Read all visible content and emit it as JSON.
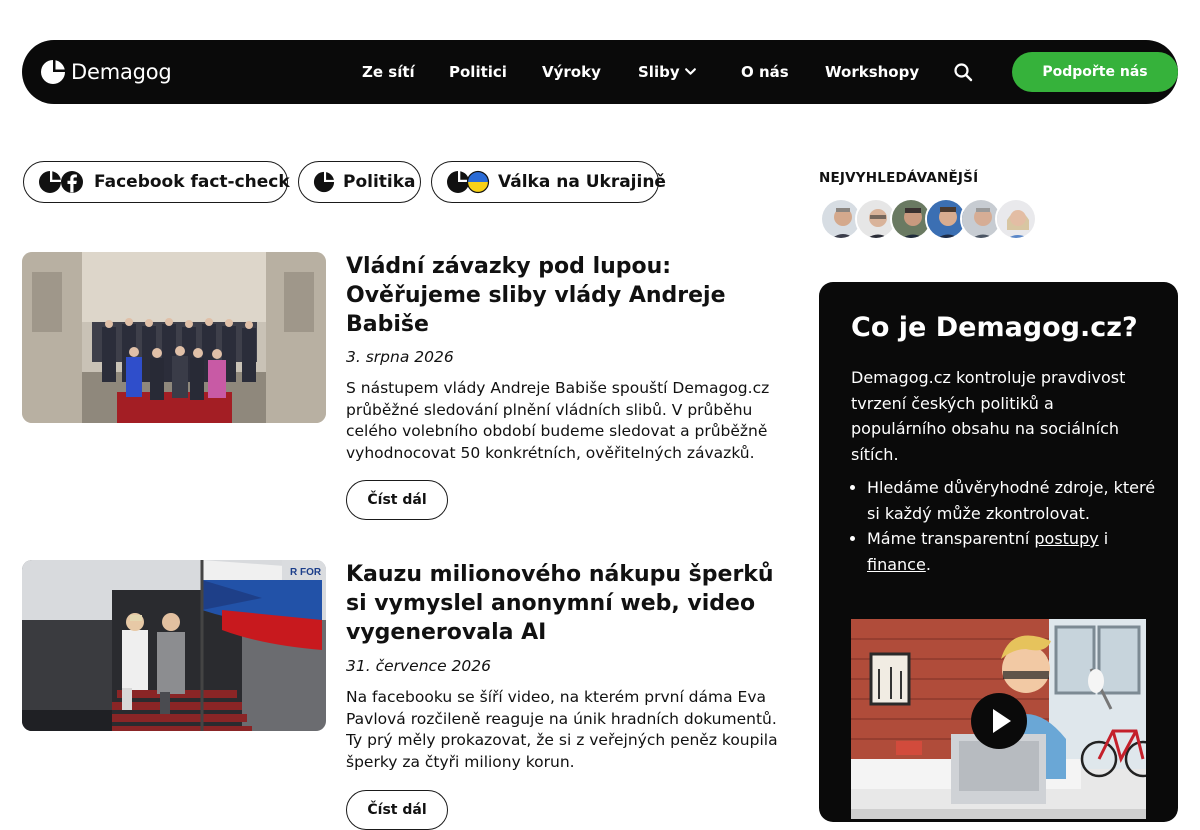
{
  "brand": {
    "name": "Demagog"
  },
  "nav": {
    "items": [
      {
        "label": "Ze sítí"
      },
      {
        "label": "Politici"
      },
      {
        "label": "Výroky"
      },
      {
        "label": "Sliby"
      },
      {
        "label": "O nás"
      },
      {
        "label": "Workshopy"
      }
    ],
    "support_label": "Podpořte nás"
  },
  "tags": [
    {
      "label": "Facebook fact-check"
    },
    {
      "label": "Politika"
    },
    {
      "label": "Válka na Ukrajině"
    }
  ],
  "articles": [
    {
      "title": "Vládní závazky pod lupou: Ověřujeme sliby vlády Andreje Babiše",
      "date": "3. srpna 2026",
      "excerpt": "S nástupem vlády Andreje Babiše spouští Demagog.cz průběžné sledování plnění vládních slibů. V průběhu celého volebního období budeme sledovat a průběžně vyhodnocovat 50 konkrétních, ověřitelných závazků.",
      "read_more": "Číst dál"
    },
    {
      "title": "Kauzu milionového nákupu šperků si vymyslel anonymní web, video vygenerovala AI",
      "date": "31. července 2026",
      "excerpt": "Na facebooku se šíří video, na kterém první dáma Eva Pavlová rozčileně reaguje na únik hradních dokumentů. Ty prý měly prokazovat, že si z veřejných peněz koupila šperky za čtyři miliony korun.",
      "read_more": "Číst dál"
    }
  ],
  "sidebar": {
    "most_viewed_title": "NEJVYHLEDÁVANĚJŠÍ",
    "about": {
      "title": "Co je Demagog.cz?",
      "text": "Demagog.cz kontroluje pravdivost tvrzení českých politiků a populárního obsahu na sociálních sítích.",
      "bullet1": "Hledáme důvěryhodné zdroje, které si každý může zkontrolovat.",
      "bullet2_prefix": "Máme transparentní ",
      "bullet2_link1": "postupy",
      "bullet2_middle": " i ",
      "bullet2_link2": "finance",
      "bullet2_suffix": "."
    }
  },
  "colors": {
    "accent_green": "#36b23b",
    "dark": "#0a0a0a",
    "ukraine_blue": "#2a6bd6",
    "ukraine_yellow": "#f7d117",
    "facebook_black": "#111111"
  }
}
